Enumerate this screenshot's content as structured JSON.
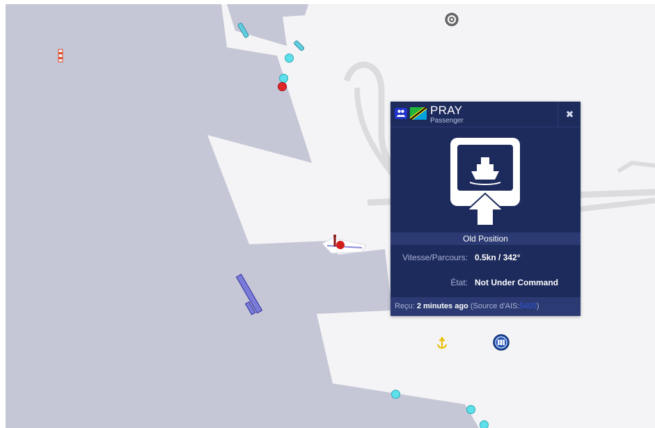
{
  "map": {
    "markers": {
      "lighthouse_icon": "lighthouse-icon",
      "settings_icon": "gear-icon",
      "anchor_icon": "anchor-icon",
      "port_icon": "port-icon"
    }
  },
  "popup": {
    "vessel_name": "PRAY",
    "vessel_type": "Passenger",
    "type_icon": "passenger-icon",
    "flag": "Tanzania",
    "close_label": "✖",
    "photo_placeholder_icon": "ship-icon",
    "position_status": "Old Position",
    "details": {
      "speed_label": "Vitesse/Parcours:",
      "speed_value": "0.5kn / 342°",
      "state_label": "État:",
      "state_value": "Not Under Command"
    },
    "received": {
      "label": "Reçu:",
      "age": "2 minutes ago",
      "source_prefix": "(Source d'AIS:",
      "source_id": "5405",
      "source_suffix": ")"
    }
  },
  "colors": {
    "sea": "#c5c6d6",
    "land": "#f4f4f6",
    "popup_bg": "#1d2a5c",
    "ais_dot": "#5ee0ea",
    "alert_dot": "#e0282b"
  }
}
